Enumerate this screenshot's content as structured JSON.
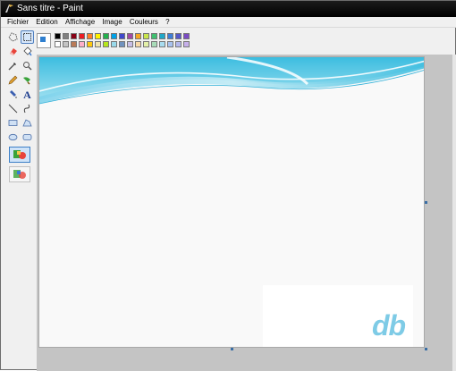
{
  "window": {
    "title": "Sans titre - Paint"
  },
  "menu": [
    {
      "label": "Fichier"
    },
    {
      "label": "Edition"
    },
    {
      "label": "Affichage"
    },
    {
      "label": "Image"
    },
    {
      "label": "Couleurs"
    },
    {
      "label": "?"
    }
  ],
  "tools": [
    {
      "name": "free-select-icon"
    },
    {
      "name": "rect-select-icon"
    },
    {
      "name": "eraser-icon"
    },
    {
      "name": "fill-bucket-icon"
    },
    {
      "name": "color-picker-icon"
    },
    {
      "name": "magnifier-icon"
    },
    {
      "name": "pencil-icon"
    },
    {
      "name": "brush-icon"
    },
    {
      "name": "airbrush-icon"
    },
    {
      "name": "text-icon"
    },
    {
      "name": "line-icon"
    },
    {
      "name": "curve-icon"
    },
    {
      "name": "rectangle-icon"
    },
    {
      "name": "polygon-icon"
    },
    {
      "name": "ellipse-icon"
    },
    {
      "name": "rounded-rect-icon"
    }
  ],
  "tool_glyphs": {
    "text_tool": "A"
  },
  "palette": {
    "current_foreground": "#2f7fcf",
    "current_background": "#ffffff",
    "row1": [
      "#000000",
      "#7f7f7f",
      "#880015",
      "#ed1c24",
      "#ff7f27",
      "#fff200",
      "#22b14c",
      "#00a2e8",
      "#3f48cc",
      "#a349a4",
      "#f5a623",
      "#c8e64c",
      "#3fbf6f",
      "#1fa8c9",
      "#3d7ed8",
      "#5458c8",
      "#7b4bc4"
    ],
    "row2": [
      "#ffffff",
      "#c3c3c3",
      "#b97a57",
      "#ffaec9",
      "#ffc90e",
      "#efe4b0",
      "#b5e61d",
      "#99d9ea",
      "#7092be",
      "#c8bfe7",
      "#f7d9a8",
      "#e3f0a8",
      "#a8dcb8",
      "#a8dcef",
      "#a8c2ee",
      "#b4b8ec",
      "#c6b0ea"
    ]
  },
  "canvas": {
    "logo_text": "db",
    "wave_color": "#4fc3e0"
  }
}
